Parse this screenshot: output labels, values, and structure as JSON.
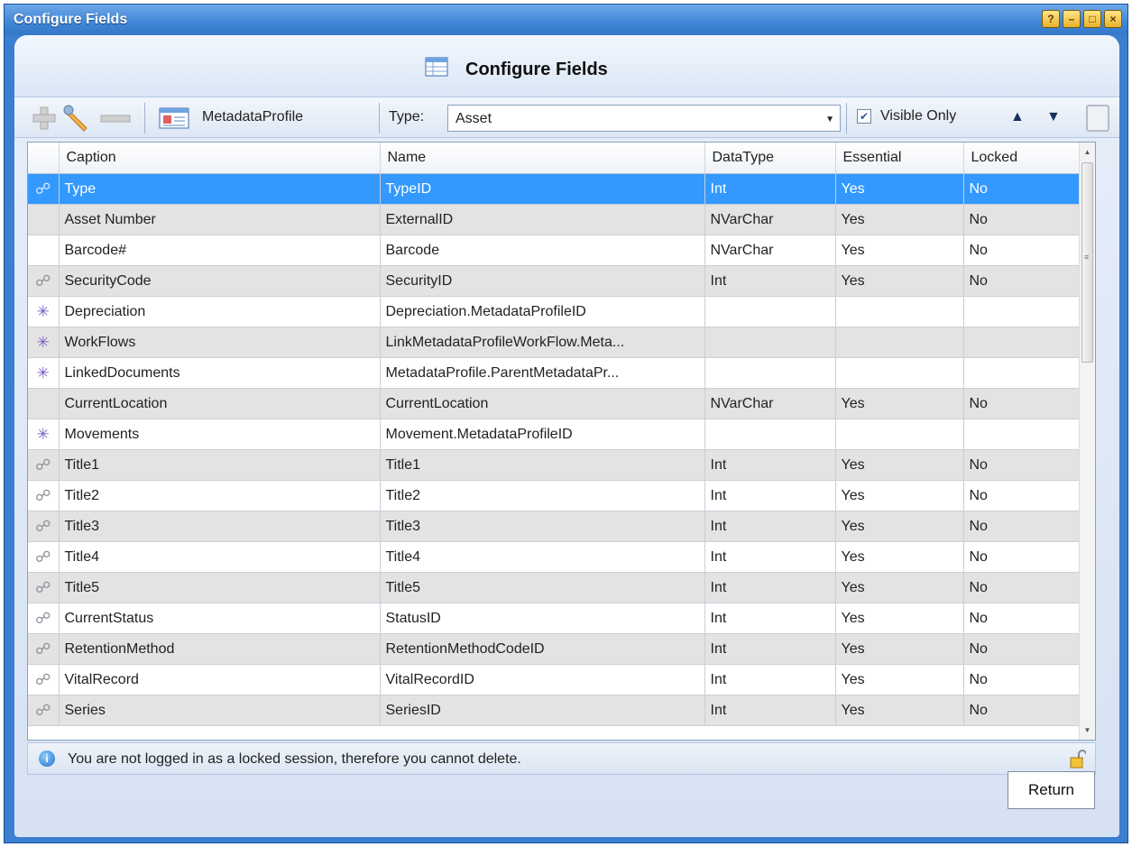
{
  "window": {
    "title": "Configure Fields",
    "controls": [
      "?",
      "–",
      "□",
      "×"
    ]
  },
  "header": {
    "icon": "table-icon",
    "title": "Configure Fields"
  },
  "toolbar": {
    "add_icon": "plus-icon",
    "edit_icon": "wrench-icon",
    "remove_icon": "minus-icon",
    "profile_icon": "profile-card-icon",
    "profile_label": "MetadataProfile",
    "type_label": "Type:",
    "type_value": "Asset",
    "visible_only_label": "Visible Only",
    "visible_only_checked": true
  },
  "grid": {
    "columns": [
      "Caption",
      "Name",
      "DataType",
      "Essential",
      "Locked"
    ],
    "selected_row": 0,
    "rows": [
      {
        "icon": "link-icon",
        "caption": "Type",
        "name": "TypeID",
        "datatype": "Int",
        "essential": "Yes",
        "locked": "No"
      },
      {
        "icon": "",
        "caption": "Asset Number",
        "name": "ExternalID",
        "datatype": "NVarChar",
        "essential": "Yes",
        "locked": "No"
      },
      {
        "icon": "",
        "caption": "Barcode#",
        "name": "Barcode",
        "datatype": "NVarChar",
        "essential": "Yes",
        "locked": "No"
      },
      {
        "icon": "link-icon",
        "caption": "SecurityCode",
        "name": "SecurityID",
        "datatype": "Int",
        "essential": "Yes",
        "locked": "No"
      },
      {
        "icon": "asterisk-icon",
        "caption": "Depreciation",
        "name": "Depreciation.MetadataProfileID",
        "datatype": "",
        "essential": "",
        "locked": ""
      },
      {
        "icon": "asterisk-icon",
        "caption": "WorkFlows",
        "name": "LinkMetadataProfileWorkFlow.Meta...",
        "datatype": "",
        "essential": "",
        "locked": ""
      },
      {
        "icon": "asterisk-icon",
        "caption": "LinkedDocuments",
        "name": "MetadataProfile.ParentMetadataPr...",
        "datatype": "",
        "essential": "",
        "locked": ""
      },
      {
        "icon": "",
        "caption": "CurrentLocation",
        "name": "CurrentLocation",
        "datatype": "NVarChar",
        "essential": "Yes",
        "locked": "No"
      },
      {
        "icon": "asterisk-icon",
        "caption": "Movements",
        "name": "Movement.MetadataProfileID",
        "datatype": "",
        "essential": "",
        "locked": ""
      },
      {
        "icon": "link-icon",
        "caption": "Title1",
        "name": "Title1",
        "datatype": "Int",
        "essential": "Yes",
        "locked": "No"
      },
      {
        "icon": "link-icon",
        "caption": "Title2",
        "name": "Title2",
        "datatype": "Int",
        "essential": "Yes",
        "locked": "No"
      },
      {
        "icon": "link-icon",
        "caption": "Title3",
        "name": "Title3",
        "datatype": "Int",
        "essential": "Yes",
        "locked": "No"
      },
      {
        "icon": "link-icon",
        "caption": "Title4",
        "name": "Title4",
        "datatype": "Int",
        "essential": "Yes",
        "locked": "No"
      },
      {
        "icon": "link-icon",
        "caption": "Title5",
        "name": "Title5",
        "datatype": "Int",
        "essential": "Yes",
        "locked": "No"
      },
      {
        "icon": "link-icon",
        "caption": "CurrentStatus",
        "name": "StatusID",
        "datatype": "Int",
        "essential": "Yes",
        "locked": "No"
      },
      {
        "icon": "link-icon",
        "caption": "RetentionMethod",
        "name": "RetentionMethodCodeID",
        "datatype": "Int",
        "essential": "Yes",
        "locked": "No"
      },
      {
        "icon": "link-icon",
        "caption": "VitalRecord",
        "name": "VitalRecordID",
        "datatype": "Int",
        "essential": "Yes",
        "locked": "No"
      },
      {
        "icon": "link-icon",
        "caption": "Series",
        "name": "SeriesID",
        "datatype": "Int",
        "essential": "Yes",
        "locked": "No"
      }
    ]
  },
  "status": {
    "icon": "info-icon",
    "message": "You are not logged in as a locked session, therefore you cannot delete.",
    "lock_icon": "unlocked-padlock-icon"
  },
  "footer": {
    "return_label": "Return"
  }
}
